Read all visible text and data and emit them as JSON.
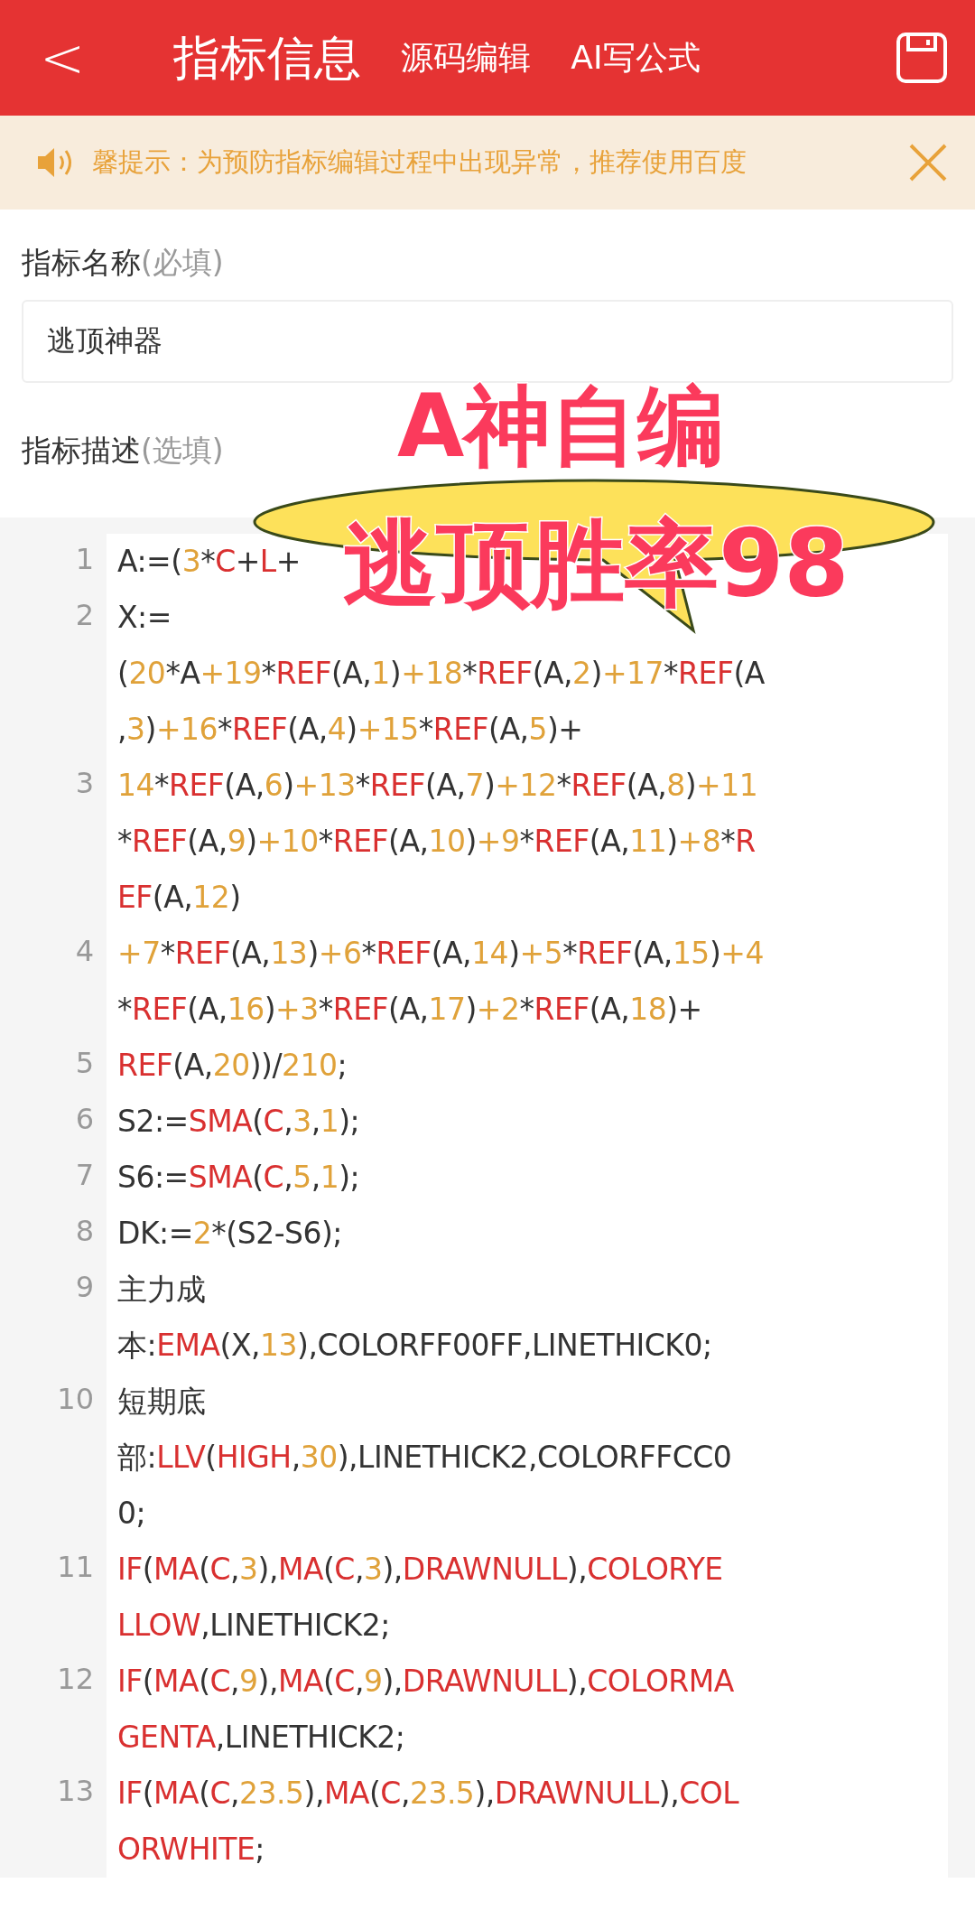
{
  "header": {
    "back": "<",
    "title": "指标信息",
    "tabs": [
      {
        "label": "源码编辑"
      },
      {
        "label": "AI写公式"
      }
    ]
  },
  "notice": {
    "text": "馨提示：为预防指标编辑过程中出现异常，推荐使用百度"
  },
  "name_field": {
    "label": "指标名称",
    "hint": "(必填)",
    "value": "逃顶神器"
  },
  "desc_field": {
    "label": "指标描述",
    "hint": "(选填)"
  },
  "code": [
    {
      "number": "1",
      "rows": [
        {
          "tokens": [
            {
              "kind": "text",
              "text": "A:=("
            },
            {
              "kind": "num",
              "text": "3"
            },
            {
              "kind": "text",
              "text": "*"
            },
            {
              "kind": "func",
              "text": "C"
            },
            {
              "kind": "text",
              "text": "+"
            },
            {
              "kind": "func",
              "text": "L"
            },
            {
              "kind": "text",
              "text": "+"
            }
          ]
        }
      ]
    },
    {
      "number": "2",
      "rows": [
        {
          "tokens": [
            {
              "kind": "text",
              "text": "X:="
            }
          ]
        },
        {
          "tokens": [
            {
              "kind": "text",
              "text": "("
            },
            {
              "kind": "num",
              "text": "20"
            },
            {
              "kind": "text",
              "text": "*A"
            },
            {
              "kind": "num",
              "text": "+19"
            },
            {
              "kind": "text",
              "text": "*"
            },
            {
              "kind": "func",
              "text": "REF"
            },
            {
              "kind": "text",
              "text": "(A,"
            },
            {
              "kind": "num",
              "text": "1"
            },
            {
              "kind": "text",
              "text": ")"
            },
            {
              "kind": "num",
              "text": "+18"
            },
            {
              "kind": "text",
              "text": "*"
            },
            {
              "kind": "func",
              "text": "REF"
            },
            {
              "kind": "text",
              "text": "(A,"
            },
            {
              "kind": "num",
              "text": "2"
            },
            {
              "kind": "text",
              "text": ")"
            },
            {
              "kind": "num",
              "text": "+17"
            },
            {
              "kind": "text",
              "text": "*"
            },
            {
              "kind": "func",
              "text": "REF"
            },
            {
              "kind": "text",
              "text": "(A"
            }
          ]
        },
        {
          "tokens": [
            {
              "kind": "text",
              "text": ","
            },
            {
              "kind": "num",
              "text": "3"
            },
            {
              "kind": "text",
              "text": ")"
            },
            {
              "kind": "num",
              "text": "+16"
            },
            {
              "kind": "text",
              "text": "*"
            },
            {
              "kind": "func",
              "text": "REF"
            },
            {
              "kind": "text",
              "text": "(A,"
            },
            {
              "kind": "num",
              "text": "4"
            },
            {
              "kind": "text",
              "text": ")"
            },
            {
              "kind": "num",
              "text": "+15"
            },
            {
              "kind": "text",
              "text": "*"
            },
            {
              "kind": "func",
              "text": "REF"
            },
            {
              "kind": "text",
              "text": "(A,"
            },
            {
              "kind": "num",
              "text": "5"
            },
            {
              "kind": "text",
              "text": ")+"
            }
          ]
        }
      ]
    },
    {
      "number": "3",
      "rows": [
        {
          "tokens": [
            {
              "kind": "num",
              "text": "14"
            },
            {
              "kind": "text",
              "text": "*"
            },
            {
              "kind": "func",
              "text": "REF"
            },
            {
              "kind": "text",
              "text": "(A,"
            },
            {
              "kind": "num",
              "text": "6"
            },
            {
              "kind": "text",
              "text": ")"
            },
            {
              "kind": "num",
              "text": "+13"
            },
            {
              "kind": "text",
              "text": "*"
            },
            {
              "kind": "func",
              "text": "REF"
            },
            {
              "kind": "text",
              "text": "(A,"
            },
            {
              "kind": "num",
              "text": "7"
            },
            {
              "kind": "text",
              "text": ")"
            },
            {
              "kind": "num",
              "text": "+12"
            },
            {
              "kind": "text",
              "text": "*"
            },
            {
              "kind": "func",
              "text": "REF"
            },
            {
              "kind": "text",
              "text": "(A,"
            },
            {
              "kind": "num",
              "text": "8"
            },
            {
              "kind": "text",
              "text": ")"
            },
            {
              "kind": "num",
              "text": "+11"
            }
          ]
        },
        {
          "tokens": [
            {
              "kind": "text",
              "text": "*"
            },
            {
              "kind": "func",
              "text": "REF"
            },
            {
              "kind": "text",
              "text": "(A,"
            },
            {
              "kind": "num",
              "text": "9"
            },
            {
              "kind": "text",
              "text": ")"
            },
            {
              "kind": "num",
              "text": "+10"
            },
            {
              "kind": "text",
              "text": "*"
            },
            {
              "kind": "func",
              "text": "REF"
            },
            {
              "kind": "text",
              "text": "(A,"
            },
            {
              "kind": "num",
              "text": "10"
            },
            {
              "kind": "text",
              "text": ")"
            },
            {
              "kind": "num",
              "text": "+9"
            },
            {
              "kind": "text",
              "text": "*"
            },
            {
              "kind": "func",
              "text": "REF"
            },
            {
              "kind": "text",
              "text": "(A,"
            },
            {
              "kind": "num",
              "text": "11"
            },
            {
              "kind": "text",
              "text": ")"
            },
            {
              "kind": "num",
              "text": "+8"
            },
            {
              "kind": "text",
              "text": "*"
            },
            {
              "kind": "func",
              "text": "R"
            }
          ]
        },
        {
          "tokens": [
            {
              "kind": "func",
              "text": "EF"
            },
            {
              "kind": "text",
              "text": "(A,"
            },
            {
              "kind": "num",
              "text": "12"
            },
            {
              "kind": "text",
              "text": ")"
            }
          ]
        }
      ]
    },
    {
      "number": "4",
      "rows": [
        {
          "tokens": [
            {
              "kind": "num",
              "text": "+7"
            },
            {
              "kind": "text",
              "text": "*"
            },
            {
              "kind": "func",
              "text": "REF"
            },
            {
              "kind": "text",
              "text": "(A,"
            },
            {
              "kind": "num",
              "text": "13"
            },
            {
              "kind": "text",
              "text": ")"
            },
            {
              "kind": "num",
              "text": "+6"
            },
            {
              "kind": "text",
              "text": "*"
            },
            {
              "kind": "func",
              "text": "REF"
            },
            {
              "kind": "text",
              "text": "(A,"
            },
            {
              "kind": "num",
              "text": "14"
            },
            {
              "kind": "text",
              "text": ")"
            },
            {
              "kind": "num",
              "text": "+5"
            },
            {
              "kind": "text",
              "text": "*"
            },
            {
              "kind": "func",
              "text": "REF"
            },
            {
              "kind": "text",
              "text": "(A,"
            },
            {
              "kind": "num",
              "text": "15"
            },
            {
              "kind": "text",
              "text": ")"
            },
            {
              "kind": "num",
              "text": "+4"
            }
          ]
        },
        {
          "tokens": [
            {
              "kind": "text",
              "text": "*"
            },
            {
              "kind": "func",
              "text": "REF"
            },
            {
              "kind": "text",
              "text": "(A,"
            },
            {
              "kind": "num",
              "text": "16"
            },
            {
              "kind": "text",
              "text": ")"
            },
            {
              "kind": "num",
              "text": "+3"
            },
            {
              "kind": "text",
              "text": "*"
            },
            {
              "kind": "func",
              "text": "REF"
            },
            {
              "kind": "text",
              "text": "(A,"
            },
            {
              "kind": "num",
              "text": "17"
            },
            {
              "kind": "text",
              "text": ")"
            },
            {
              "kind": "num",
              "text": "+2"
            },
            {
              "kind": "text",
              "text": "*"
            },
            {
              "kind": "func",
              "text": "REF"
            },
            {
              "kind": "text",
              "text": "(A,"
            },
            {
              "kind": "num",
              "text": "18"
            },
            {
              "kind": "text",
              "text": ")+"
            }
          ]
        }
      ]
    },
    {
      "number": "5",
      "rows": [
        {
          "tokens": [
            {
              "kind": "func",
              "text": "REF"
            },
            {
              "kind": "text",
              "text": "(A,"
            },
            {
              "kind": "num",
              "text": "20"
            },
            {
              "kind": "text",
              "text": "))/"
            },
            {
              "kind": "num",
              "text": "210"
            },
            {
              "kind": "text",
              "text": ";"
            }
          ]
        }
      ]
    },
    {
      "number": "6",
      "rows": [
        {
          "tokens": [
            {
              "kind": "text",
              "text": "S2:="
            },
            {
              "kind": "func",
              "text": "SMA"
            },
            {
              "kind": "text",
              "text": "("
            },
            {
              "kind": "func",
              "text": "C"
            },
            {
              "kind": "text",
              "text": ","
            },
            {
              "kind": "num",
              "text": "3"
            },
            {
              "kind": "text",
              "text": ","
            },
            {
              "kind": "num",
              "text": "1"
            },
            {
              "kind": "text",
              "text": ");"
            }
          ]
        }
      ]
    },
    {
      "number": "7",
      "rows": [
        {
          "tokens": [
            {
              "kind": "text",
              "text": "S6:="
            },
            {
              "kind": "func",
              "text": "SMA"
            },
            {
              "kind": "text",
              "text": "("
            },
            {
              "kind": "func",
              "text": "C"
            },
            {
              "kind": "text",
              "text": ","
            },
            {
              "kind": "num",
              "text": "5"
            },
            {
              "kind": "text",
              "text": ","
            },
            {
              "kind": "num",
              "text": "1"
            },
            {
              "kind": "text",
              "text": ");"
            }
          ]
        }
      ]
    },
    {
      "number": "8",
      "rows": [
        {
          "tokens": [
            {
              "kind": "text",
              "text": "DK:="
            },
            {
              "kind": "num",
              "text": "2"
            },
            {
              "kind": "text",
              "text": "*(S2-S6);"
            }
          ]
        }
      ]
    },
    {
      "number": "9",
      "rows": [
        {
          "tokens": [
            {
              "kind": "text",
              "text": "主力成"
            }
          ]
        },
        {
          "tokens": [
            {
              "kind": "text",
              "text": "本:"
            },
            {
              "kind": "func",
              "text": "EMA"
            },
            {
              "kind": "text",
              "text": "(X,"
            },
            {
              "kind": "num",
              "text": "13"
            },
            {
              "kind": "text",
              "text": "),COLORFF00FF,LINETHICK0;"
            }
          ]
        }
      ]
    },
    {
      "number": "10",
      "rows": [
        {
          "tokens": [
            {
              "kind": "text",
              "text": "短期底"
            }
          ]
        },
        {
          "tokens": [
            {
              "kind": "text",
              "text": "部:"
            },
            {
              "kind": "func",
              "text": "LLV"
            },
            {
              "kind": "text",
              "text": "("
            },
            {
              "kind": "func",
              "text": "HIGH"
            },
            {
              "kind": "text",
              "text": ","
            },
            {
              "kind": "num",
              "text": "30"
            },
            {
              "kind": "text",
              "text": "),LINETHICK2,COLORFFCC0"
            }
          ]
        },
        {
          "tokens": [
            {
              "kind": "text",
              "text": "0;"
            }
          ]
        }
      ]
    },
    {
      "number": "11",
      "rows": [
        {
          "tokens": [
            {
              "kind": "func",
              "text": "IF"
            },
            {
              "kind": "text",
              "text": "("
            },
            {
              "kind": "func",
              "text": "MA"
            },
            {
              "kind": "text",
              "text": "("
            },
            {
              "kind": "func",
              "text": "C"
            },
            {
              "kind": "text",
              "text": ","
            },
            {
              "kind": "num",
              "text": "3"
            },
            {
              "kind": "text",
              "text": "),"
            },
            {
              "kind": "func",
              "text": "MA"
            },
            {
              "kind": "text",
              "text": "("
            },
            {
              "kind": "func",
              "text": "C"
            },
            {
              "kind": "text",
              "text": ","
            },
            {
              "kind": "num",
              "text": "3"
            },
            {
              "kind": "text",
              "text": "),"
            },
            {
              "kind": "func",
              "text": "DRAWNULL"
            },
            {
              "kind": "text",
              "text": "),"
            },
            {
              "kind": "func",
              "text": "COLORYE"
            }
          ]
        },
        {
          "tokens": [
            {
              "kind": "func",
              "text": "LLOW"
            },
            {
              "kind": "text",
              "text": ",LINETHICK2;"
            }
          ]
        }
      ]
    },
    {
      "number": "12",
      "rows": [
        {
          "tokens": [
            {
              "kind": "func",
              "text": "IF"
            },
            {
              "kind": "text",
              "text": "("
            },
            {
              "kind": "func",
              "text": "MA"
            },
            {
              "kind": "text",
              "text": "("
            },
            {
              "kind": "func",
              "text": "C"
            },
            {
              "kind": "text",
              "text": ","
            },
            {
              "kind": "num",
              "text": "9"
            },
            {
              "kind": "text",
              "text": "),"
            },
            {
              "kind": "func",
              "text": "MA"
            },
            {
              "kind": "text",
              "text": "("
            },
            {
              "kind": "func",
              "text": "C"
            },
            {
              "kind": "text",
              "text": ","
            },
            {
              "kind": "num",
              "text": "9"
            },
            {
              "kind": "text",
              "text": "),"
            },
            {
              "kind": "func",
              "text": "DRAWNULL"
            },
            {
              "kind": "text",
              "text": "),"
            },
            {
              "kind": "func",
              "text": "COLORMA"
            }
          ]
        },
        {
          "tokens": [
            {
              "kind": "func",
              "text": "GENTA"
            },
            {
              "kind": "text",
              "text": ",LINETHICK2;"
            }
          ]
        }
      ]
    },
    {
      "number": "13",
      "rows": [
        {
          "tokens": [
            {
              "kind": "func",
              "text": "IF"
            },
            {
              "kind": "text",
              "text": "("
            },
            {
              "kind": "func",
              "text": "MA"
            },
            {
              "kind": "text",
              "text": "("
            },
            {
              "kind": "func",
              "text": "C"
            },
            {
              "kind": "text",
              "text": ","
            },
            {
              "kind": "num",
              "text": "23.5"
            },
            {
              "kind": "text",
              "text": "),"
            },
            {
              "kind": "func",
              "text": "MA"
            },
            {
              "kind": "text",
              "text": "("
            },
            {
              "kind": "func",
              "text": "C"
            },
            {
              "kind": "text",
              "text": ","
            },
            {
              "kind": "num",
              "text": "23.5"
            },
            {
              "kind": "text",
              "text": "),"
            },
            {
              "kind": "func",
              "text": "DRAWNULL"
            },
            {
              "kind": "text",
              "text": "),"
            },
            {
              "kind": "func",
              "text": "COL"
            }
          ]
        },
        {
          "tokens": [
            {
              "kind": "func",
              "text": "ORWHITE"
            },
            {
              "kind": "text",
              "text": ";"
            }
          ]
        }
      ]
    }
  ],
  "overlay": {
    "lines": [
      "A神自编",
      "逃顶胜率98"
    ]
  }
}
